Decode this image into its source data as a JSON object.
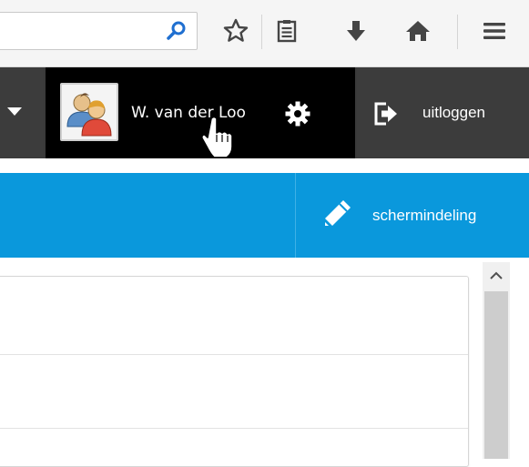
{
  "toolbar": {
    "icons": [
      "search-icon",
      "bookmark-star-icon",
      "reading-list-icon",
      "download-icon",
      "home-icon",
      "hamburger-menu-icon"
    ]
  },
  "header": {
    "user_name": "W. van der Loo",
    "logout_label": "uitloggen",
    "icons": [
      "avatar-users-icon",
      "gear-icon",
      "logout-icon"
    ]
  },
  "bluebar": {
    "layout_label": "schermindeling",
    "icons": [
      "pencil-icon"
    ]
  },
  "colors": {
    "header_bg": "#000000",
    "header_segment": "#3c3c3c",
    "accent_blue": "#0a98dc",
    "toolbar_bg": "#f5f5f5"
  }
}
